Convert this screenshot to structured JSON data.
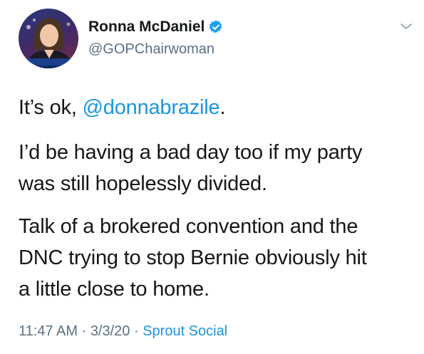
{
  "tweet": {
    "author_name": "Ronna McDaniel",
    "handle": "@GOPChairwoman",
    "verified": true,
    "line1_prefix": "It’s ok, ",
    "line1_mention": "@donnabrazile",
    "line1_suffix": ".",
    "para2_line1": "I’d be having a bad day too if my party",
    "para2_line2": "was still hopelessly divided.",
    "para3_line1": "Talk of a brokered convention and the",
    "para3_line2": "DNC trying to stop Bernie obviously hit",
    "para3_line3": "a little close to home.",
    "time": "11:47 AM",
    "separator1": " · ",
    "date": "3/3/20",
    "separator2": " · ",
    "source": "Sprout Social"
  },
  "colors": {
    "text": "#14171a",
    "secondary": "#5b7083",
    "link": "#1b95e0",
    "verified_badge": "#1da1f2"
  },
  "icons": {
    "verified": "verified-badge-icon",
    "menu": "chevron-down-icon"
  }
}
